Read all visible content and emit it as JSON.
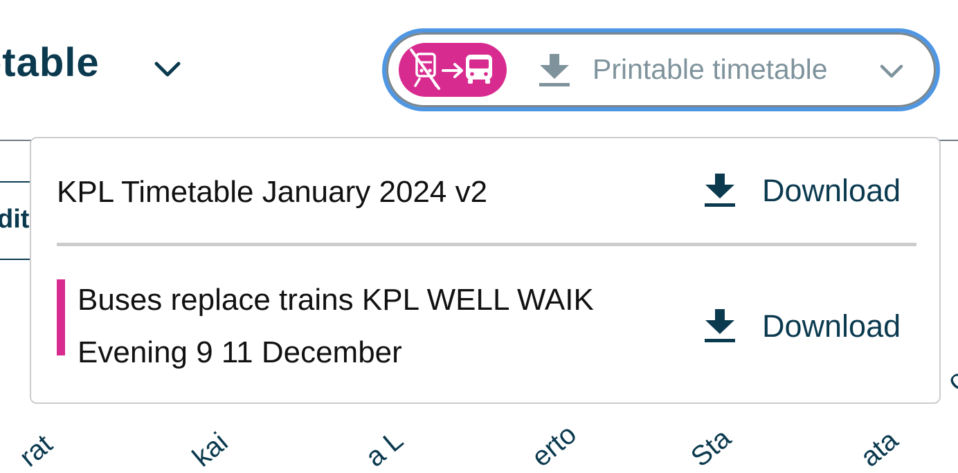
{
  "header": {
    "title": "etable"
  },
  "printable_menu": {
    "label": "Printable timetable",
    "badge_icon": "train-to-bus-replacement-icon",
    "download_icon": "download-icon",
    "toggle_icon": "chevron-down-icon",
    "badge_color": "#d82b90",
    "focus_ring_color": "#4f96e3"
  },
  "background": {
    "edit_button_fragment": "dit",
    "stop_labels": [
      "rat",
      "kai",
      "a L",
      "erto",
      "Sta",
      "ata",
      "on"
    ]
  },
  "dropdown": {
    "items": [
      {
        "title": "KPL Timetable January 2024 v2",
        "download_label": "Download",
        "highlighted": false
      },
      {
        "title": "Buses replace trains KPL WELL WAIK Evening 9 11 December",
        "download_label": "Download",
        "highlighted": true,
        "accent_color": "#d82b90"
      }
    ]
  },
  "colors": {
    "primary_text": "#0b3a4f",
    "muted_text": "#7f939c",
    "accent": "#d82b90"
  }
}
